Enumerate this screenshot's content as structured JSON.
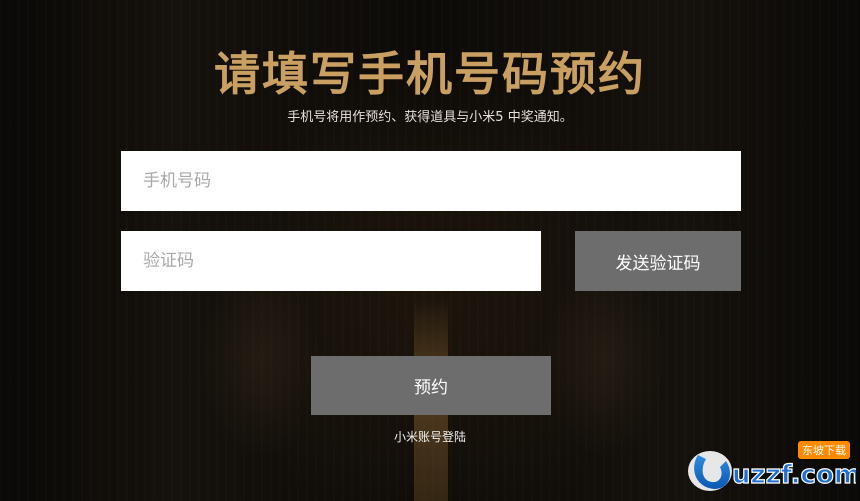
{
  "heading": "请填写手机号码预约",
  "subheading": "手机号将用作预约、获得道具与小米5 中奖通知。",
  "phone_field": {
    "placeholder": "手机号码",
    "value": ""
  },
  "code_field": {
    "placeholder": "验证码",
    "value": ""
  },
  "send_code_label": "发送验证码",
  "reserve_label": "预约",
  "mi_login_label": "小米账号登陆",
  "watermark": {
    "brand": "uzzf.com",
    "tag": "东坡下载"
  },
  "colors": {
    "title": "#c9a061",
    "button": "#6d6d6d",
    "background": "#0b0a08"
  }
}
